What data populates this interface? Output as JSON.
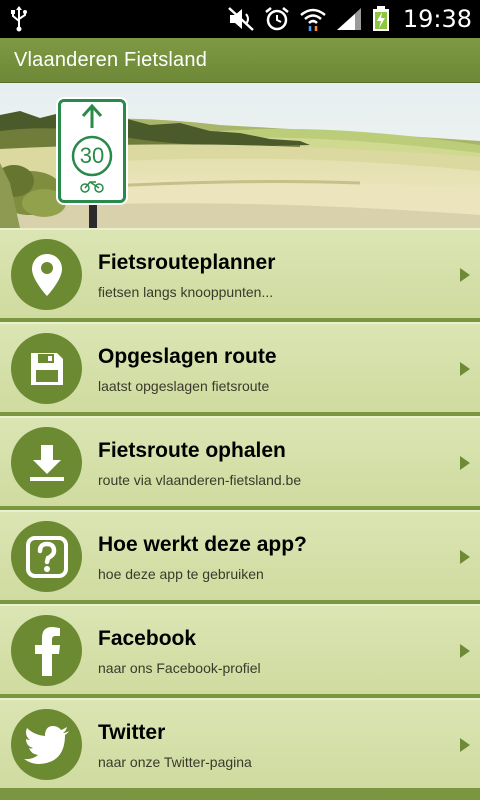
{
  "status_bar": {
    "time": "19:38",
    "icons": [
      "usb-icon",
      "mute-icon",
      "alarm-icon",
      "wifi-icon",
      "signal-icon",
      "battery-charging-icon"
    ]
  },
  "action_bar": {
    "title": "Vlaanderen Fietsland"
  },
  "banner": {
    "sign_number": "30"
  },
  "colors": {
    "accent": "#6c8a32",
    "item_bg": "#d6e0ac",
    "action_bar": "#7b9640"
  },
  "menu": [
    {
      "title": "Fietsrouteplanner",
      "subtitle": "fietsen langs knooppunten...",
      "icon": "location-pin-icon"
    },
    {
      "title": "Opgeslagen route",
      "subtitle": "laatst opgeslagen fietsroute",
      "icon": "save-icon"
    },
    {
      "title": "Fietsroute ophalen",
      "subtitle": "route via vlaanderen-fietsland.be",
      "icon": "download-icon"
    },
    {
      "title": "Hoe werkt deze app?",
      "subtitle": "hoe deze app te gebruiken",
      "icon": "help-icon"
    },
    {
      "title": "Facebook",
      "subtitle": "naar ons Facebook-profiel",
      "icon": "facebook-icon"
    },
    {
      "title": "Twitter",
      "subtitle": "naar onze Twitter-pagina",
      "icon": "twitter-icon"
    }
  ]
}
